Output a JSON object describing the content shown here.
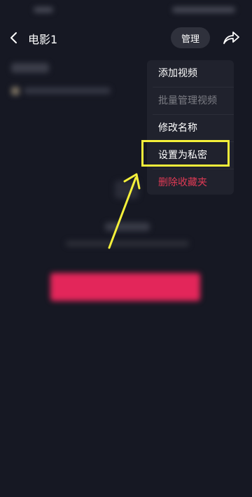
{
  "header": {
    "title": "电影1",
    "manage_label": "管理"
  },
  "menu": {
    "items": [
      {
        "label": "添加视频",
        "state": "normal"
      },
      {
        "label": "批量管理视频",
        "state": "disabled"
      },
      {
        "label": "修改名称",
        "state": "normal"
      },
      {
        "label": "设置为私密",
        "state": "highlighted"
      },
      {
        "label": "删除收藏夹",
        "state": "danger"
      }
    ]
  },
  "colors": {
    "background": "#161823",
    "menu_background": "#20222d",
    "danger": "#e03a55",
    "cta": "#e3265a",
    "annotation": "#f5f03a"
  },
  "icons": {
    "back": "chevron-left-icon",
    "share": "share-arrow-icon"
  }
}
